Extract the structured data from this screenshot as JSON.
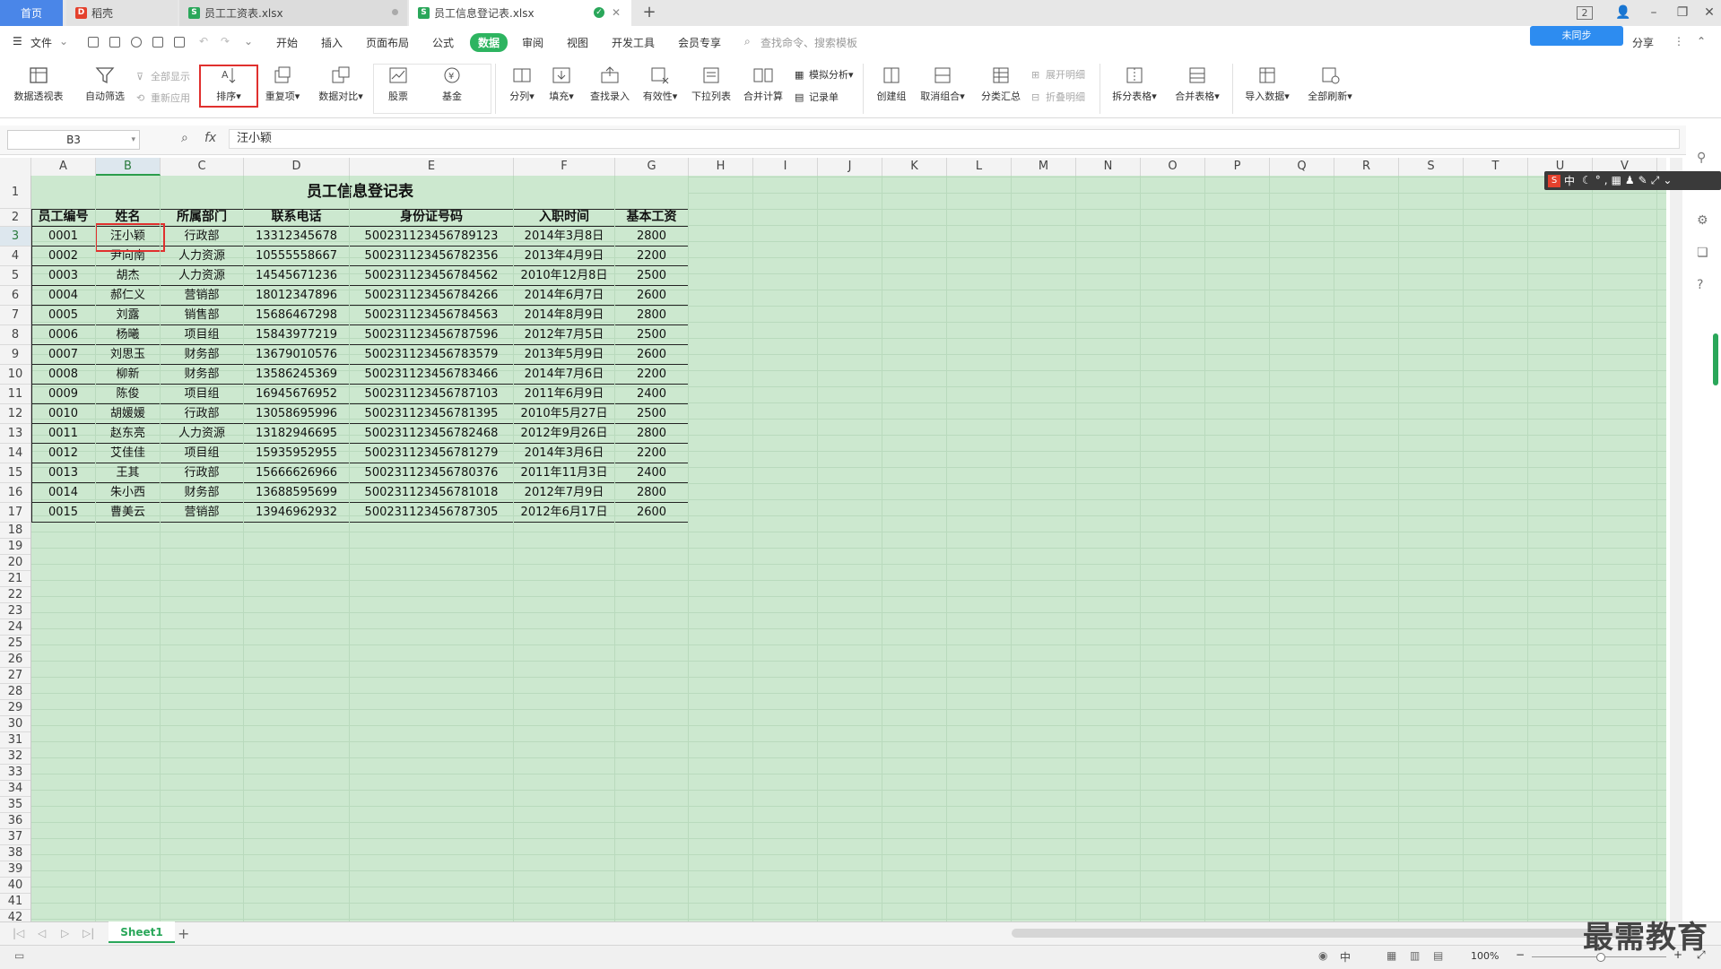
{
  "tabs": {
    "home": "首页",
    "t1": "稻壳",
    "t2": "员工工资表.xlsx",
    "t3": "员工信息登记表.xlsx"
  },
  "user_badge": "2",
  "menu": {
    "file": "文件",
    "items": [
      "开始",
      "插入",
      "页面布局",
      "公式",
      "数据",
      "审阅",
      "视图",
      "开发工具",
      "会员专享"
    ],
    "active": "数据",
    "search": "查找命令、搜索模板",
    "share": "分享",
    "sync": "未同步"
  },
  "ribbon": {
    "pivot": "数据透视表",
    "autofilter": "自动筛选",
    "show_all": "全部显示",
    "reapply": "重新应用",
    "sort": "排序",
    "dup": "重复项",
    "compare": "数据对比",
    "stock": "股票",
    "fund": "基金",
    "split": "分列",
    "fill": "填充",
    "lookup": "查找录入",
    "valid": "有效性",
    "dropdown": "下拉列表",
    "merge_calc": "合并计算",
    "simulate": "模拟分析",
    "record": "记录单",
    "create_group": "创建组",
    "ungroup": "取消组合",
    "subtotal": "分类汇总",
    "expand": "展开明细",
    "collapse": "折叠明细",
    "split_table": "拆分表格",
    "merge_table": "合并表格",
    "import": "导入数据",
    "refresh": "全部刷新"
  },
  "formula": {
    "cell": "B3",
    "fx": "fx",
    "value": "汪小颖"
  },
  "columns": [
    "A",
    "B",
    "C",
    "D",
    "E",
    "F",
    "G",
    "H",
    "I",
    "J",
    "K",
    "L",
    "M",
    "N",
    "O",
    "P",
    "Q",
    "R",
    "S",
    "T",
    "U",
    "V"
  ],
  "table": {
    "title": "员工信息登记表",
    "headers": [
      "员工编号",
      "姓名",
      "所属部门",
      "联系电话",
      "身份证号码",
      "入职时间",
      "基本工资"
    ],
    "rows": [
      [
        "0001",
        "汪小颖",
        "行政部",
        "13312345678",
        "500231123456789123",
        "2014年3月8日",
        "2800"
      ],
      [
        "0002",
        "尹向南",
        "人力资源",
        "10555558667",
        "500231123456782356",
        "2013年4月9日",
        "2200"
      ],
      [
        "0003",
        "胡杰",
        "人力资源",
        "14545671236",
        "500231123456784562",
        "2010年12月8日",
        "2500"
      ],
      [
        "0004",
        "郝仁义",
        "营销部",
        "18012347896",
        "500231123456784266",
        "2014年6月7日",
        "2600"
      ],
      [
        "0005",
        "刘露",
        "销售部",
        "15686467298",
        "500231123456784563",
        "2014年8月9日",
        "2800"
      ],
      [
        "0006",
        "杨曦",
        "项目组",
        "15843977219",
        "500231123456787596",
        "2012年7月5日",
        "2500"
      ],
      [
        "0007",
        "刘思玉",
        "财务部",
        "13679010576",
        "500231123456783579",
        "2013年5月9日",
        "2600"
      ],
      [
        "0008",
        "柳新",
        "财务部",
        "13586245369",
        "500231123456783466",
        "2014年7月6日",
        "2200"
      ],
      [
        "0009",
        "陈俊",
        "项目组",
        "16945676952",
        "500231123456787103",
        "2011年6月9日",
        "2400"
      ],
      [
        "0010",
        "胡媛媛",
        "行政部",
        "13058695996",
        "500231123456781395",
        "2010年5月27日",
        "2500"
      ],
      [
        "0011",
        "赵东亮",
        "人力资源",
        "13182946695",
        "500231123456782468",
        "2012年9月26日",
        "2800"
      ],
      [
        "0012",
        "艾佳佳",
        "项目组",
        "15935952955",
        "500231123456781279",
        "2014年3月6日",
        "2200"
      ],
      [
        "0013",
        "王其",
        "行政部",
        "15666626966",
        "500231123456780376",
        "2011年11月3日",
        "2400"
      ],
      [
        "0014",
        "朱小西",
        "财务部",
        "13688595699",
        "500231123456781018",
        "2012年7月9日",
        "2800"
      ],
      [
        "0015",
        "曹美云",
        "营销部",
        "13946962932",
        "500231123456787305",
        "2012年6月17日",
        "2600"
      ]
    ]
  },
  "ime": "中",
  "sheet": {
    "name": "Sheet1"
  },
  "status": {
    "zoom": "100%",
    "lang": "中"
  },
  "watermark": "最需教育"
}
